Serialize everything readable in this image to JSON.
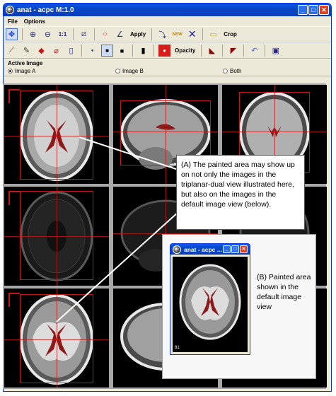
{
  "window": {
    "title": "anat - acpc  M:1.0",
    "controls": [
      "_",
      "□",
      "✕"
    ]
  },
  "menu": [
    "File",
    "Options"
  ],
  "toolbar1": {
    "fit_label": "1:1",
    "apply_label": "Apply",
    "new_label": "NEW",
    "crop_label": "Crop",
    "icons": [
      "move-icon",
      "zoom-in-icon",
      "zoom-out-icon",
      "reset-zoom-icon",
      "line-icon",
      "points-icon",
      "angle-icon",
      "apply-icon",
      "new-point-icon",
      "delete-icon",
      "bounding-box-icon",
      "crop-icon"
    ]
  },
  "toolbar2": {
    "opacity_label": "Opacity",
    "icons": [
      "paint-brush-icon",
      "dropper-icon",
      "fill-icon",
      "eraser-icon",
      "blank-page-icon",
      "brush-small-icon",
      "brush-medium-icon",
      "brush-large-icon",
      "brush-tall-icon",
      "color-swatch-icon",
      "paint-to-mask-icon",
      "mask-to-paint-icon",
      "undo-icon",
      "save-icon"
    ]
  },
  "active_image": {
    "heading": "Active Image",
    "options": [
      {
        "label": "Image A",
        "selected": true
      },
      {
        "label": "Image B",
        "selected": false
      },
      {
        "label": "Both",
        "selected": false
      }
    ]
  },
  "callout_a": "(A) The painted area may show up on not only the images in the triplanar-dual view illustrated here, but also on the images in the default image view (below).",
  "default_window": {
    "title": "anat - acpc ...",
    "slice_number": "81"
  },
  "callout_b": "(B) Painted area shown in the default image view",
  "colors": {
    "titlebar": "#0746c8",
    "crosshair": "#c01818",
    "paint": "#8b1a1a"
  }
}
